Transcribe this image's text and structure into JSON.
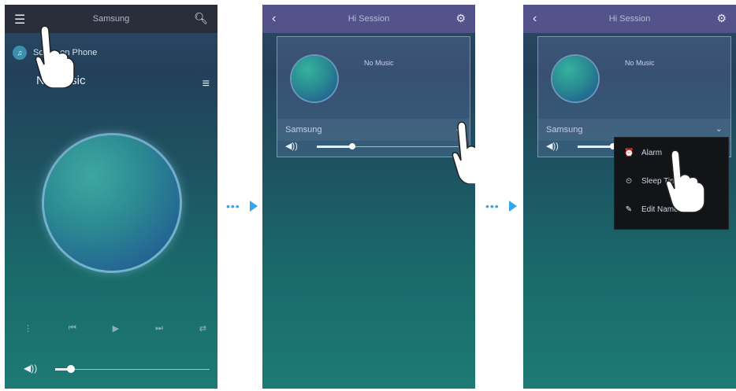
{
  "colors": {
    "accent_arrow": "#34a6ea",
    "screen_bg_top": "#2b4a66",
    "screen_bg_bottom": "#1d7a75",
    "topbar_purple": "#53528b",
    "popup_bg": "#121418"
  },
  "screen1": {
    "topbar_title": "Samsung",
    "menu_toggle_icon": "drawer-icon",
    "search_icon": "search-icon",
    "source_label": "Songs on Phone",
    "now_playing_label": "No Music",
    "list_icon": "list-icon",
    "controls": [
      "repeat",
      "prev",
      "play",
      "next",
      "shuffle"
    ],
    "volume_fraction": 0.1
  },
  "screen2": {
    "topbar_title": "Hi Session",
    "back_icon": "back-icon",
    "settings_icon": "gear-icon",
    "panel_nomusic": "No Music",
    "device_name": "Samsung",
    "chevron_icon": "chevron-down-icon",
    "volume_fraction": 0.25
  },
  "screen3": {
    "topbar_title": "Hi Session",
    "back_icon": "back-icon",
    "settings_icon": "gear-icon",
    "panel_nomusic": "No Music",
    "device_name": "Samsung",
    "chevron_icon": "chevron-down-icon",
    "volume_fraction": 0.25,
    "popup_items": [
      {
        "label": "Alarm",
        "icon": "alarm-icon"
      },
      {
        "label": "Sleep Timer",
        "icon": "timer-icon"
      },
      {
        "label": "Edit Name",
        "icon": "edit-icon"
      }
    ]
  }
}
